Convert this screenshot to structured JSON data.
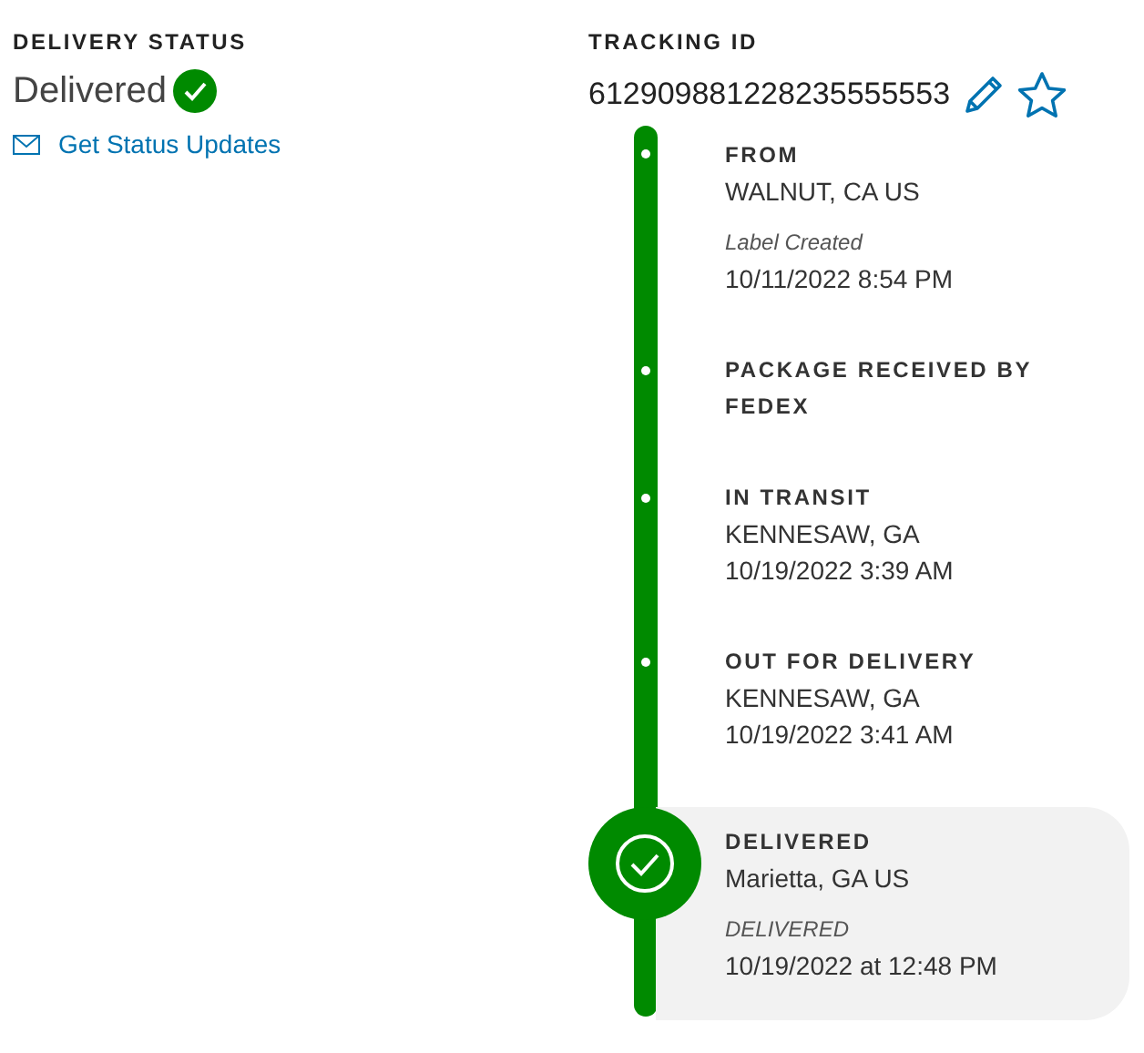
{
  "delivery_status": {
    "label": "DELIVERY STATUS",
    "status": "Delivered",
    "delivered": true,
    "link": "Get Status Updates"
  },
  "tracking": {
    "label": "TRACKING ID",
    "number": "612909881228235555553"
  },
  "events": [
    {
      "kind": "step",
      "title": "FROM",
      "location": "WALNUT, CA US",
      "note": "Label Created",
      "time": "10/11/2022 8:54 PM"
    },
    {
      "kind": "step",
      "title": "PACKAGE RECEIVED BY FEDEX"
    },
    {
      "kind": "step",
      "title": "IN TRANSIT",
      "location": "KENNESAW, GA",
      "time": "10/19/2022 3:39 AM"
    },
    {
      "kind": "step",
      "title": "OUT FOR DELIVERY",
      "location": "KENNESAW, GA",
      "time": "10/19/2022 3:41 AM"
    },
    {
      "kind": "current",
      "title": "DELIVERED",
      "location": "Marietta, GA US",
      "note": "DELIVERED",
      "time": "10/19/2022 at 12:48 PM"
    }
  ]
}
